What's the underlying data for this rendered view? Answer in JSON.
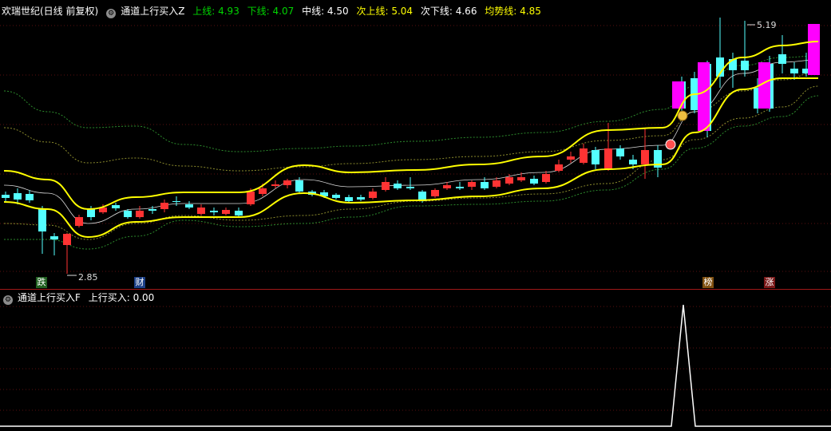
{
  "upper": {
    "stock_name": "欢瑞世纪(日线 前复权)",
    "indicator_name": "通道上行买入Z",
    "lines": [
      {
        "label": "上线: 4.93",
        "color": "#ffffff"
      },
      {
        "label": "下线: 4.07",
        "color": "#ffff00"
      },
      {
        "label": "中线: 4.50",
        "color": "#ff00ff"
      },
      {
        "label": "次上线: 5.04",
        "color": "#00e000"
      },
      {
        "label": "次下线: 4.66",
        "color": "#ffff00"
      },
      {
        "label": "均势线: 4.85",
        "color": "#ffffff"
      }
    ],
    "low_marker": "2.85",
    "high_marker": "5.19",
    "tags": [
      {
        "text": "跌",
        "color": "#20a020"
      },
      {
        "text": "财",
        "color": "#2a6ad8"
      },
      {
        "text": "榜",
        "color": "#c07010"
      },
      {
        "text": "涨",
        "color": "#d02020"
      }
    ]
  },
  "lower": {
    "indicator_name": "通道上行买入F",
    "value_label": "上行买入: 0.00"
  },
  "colors": {
    "background": "#000000",
    "up_candle": "#ff3333",
    "down_candle": "#54ffff",
    "channel": "#ffff00",
    "signal_bar": "#ff00ff",
    "separator": "#a01818"
  }
}
